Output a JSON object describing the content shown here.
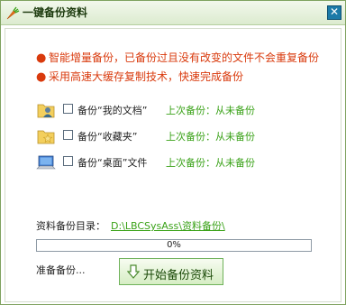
{
  "window": {
    "title": "一键备份资料",
    "close_glyph": "✕"
  },
  "intro": [
    "智能增量备份，已备份过且没有改变的文件不会重复备份",
    "采用高速大缓存复制技术，快速完成备份"
  ],
  "bullet_glyph": "●",
  "items": [
    {
      "icon": "user-folder-icon",
      "label": "备份“我的文档”",
      "checked": false,
      "status": "上次备份：从未备份"
    },
    {
      "icon": "favorites-folder-icon",
      "label": "备份“收藏夹”",
      "checked": false,
      "status": "上次备份：从未备份"
    },
    {
      "icon": "desktop-icon",
      "label": "备份“桌面”文件",
      "checked": false,
      "status": "上次备份：从未备份"
    }
  ],
  "backup_dir": {
    "label": "资料备份目录：",
    "path": "D:\\LBCSysAss\\资料备份\\"
  },
  "progress": {
    "value": 0,
    "text": "0%"
  },
  "status_text": "准备备份...",
  "start_button": {
    "label": "开始备份资料",
    "icon": "download-arrow-icon"
  },
  "colors": {
    "intro_text": "#d93a0d",
    "status_text": "#3aa218",
    "link": "#3aa218",
    "accent": "#6fc04b"
  }
}
